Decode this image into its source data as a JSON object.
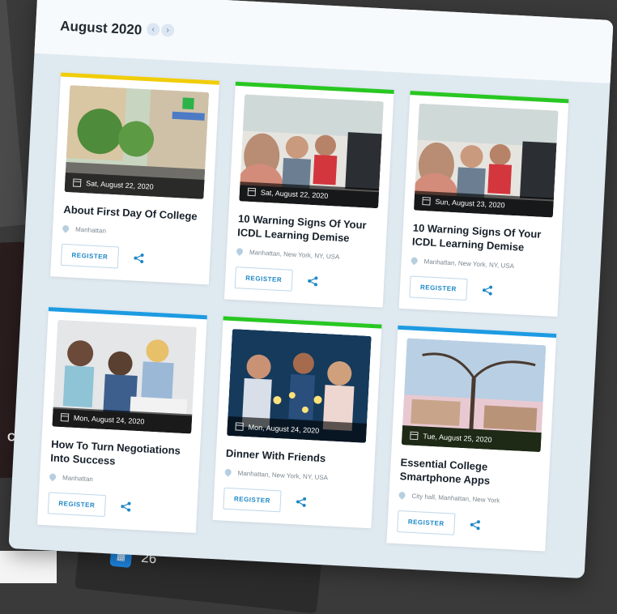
{
  "header": {
    "month_title": "August 2020",
    "prev_label": "‹",
    "next_label": "›"
  },
  "events": [
    {
      "accent": "#f0cd0a",
      "date": "Sat, August 22, 2020",
      "title": "About First Day Of College",
      "location": "Manhattan",
      "register_label": "REGISTER",
      "image": "street-scene"
    },
    {
      "accent": "#28c722",
      "date": "Sat, August 22, 2020",
      "title": "10 Warning Signs Of Your ICDL Learning Demise",
      "location": "Manhattan, New York, NY, USA",
      "register_label": "REGISTER",
      "image": "computer-lab"
    },
    {
      "accent": "#28c722",
      "date": "Sun, August 23, 2020",
      "title": "10 Warning Signs Of Your ICDL Learning Demise",
      "location": "Manhattan, New York, NY, USA",
      "register_label": "REGISTER",
      "image": "computer-lab"
    },
    {
      "accent": "#1d9be2",
      "date": "Mon, August 24, 2020",
      "title": "How To Turn Negotiations Into Success",
      "location": "Manhattan",
      "register_label": "REGISTER",
      "image": "students-group"
    },
    {
      "accent": "#28c722",
      "date": "Mon, August 24, 2020",
      "title": "Dinner With Friends",
      "location": "Manhattan, New York, NY, USA",
      "register_label": "REGISTER",
      "image": "party-lights"
    },
    {
      "accent": "#1d9be2",
      "date": "Tue, August 25, 2020",
      "title": "Essential College Smartphone Apps",
      "location": "City hall, Manhattan, New York",
      "register_label": "REGISTER",
      "image": "campus-tree"
    }
  ],
  "background": {
    "calendar_number": "26"
  }
}
